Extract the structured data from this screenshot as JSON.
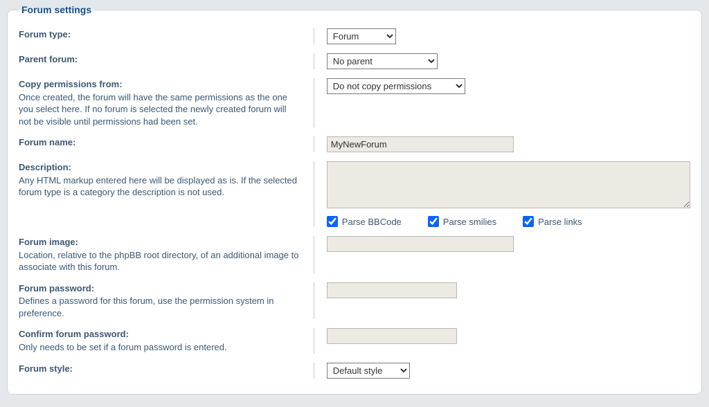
{
  "legend": "Forum settings",
  "fields": {
    "forum_type": {
      "label": "Forum type:",
      "value": "Forum"
    },
    "parent_forum": {
      "label": "Parent forum:",
      "value": "No parent"
    },
    "copy_permissions": {
      "label": "Copy permissions from:",
      "help": "Once created, the forum will have the same permissions as the one you select here. If no forum is selected the newly created forum will not be visible until permissions had been set.",
      "value": "Do not copy permissions"
    },
    "forum_name": {
      "label": "Forum name:",
      "value": "MyNewForum"
    },
    "description": {
      "label": "Description:",
      "help": "Any HTML markup entered here will be displayed as is. If the selected forum type is a category the description is not used.",
      "value": "",
      "parse_bbcode": {
        "label": "Parse BBCode",
        "checked": true
      },
      "parse_smilies": {
        "label": "Parse smilies",
        "checked": true
      },
      "parse_links": {
        "label": "Parse links",
        "checked": true
      }
    },
    "forum_image": {
      "label": "Forum image:",
      "help": "Location, relative to the phpBB root directory, of an additional image to associate with this forum.",
      "value": ""
    },
    "forum_password": {
      "label": "Forum password:",
      "help": "Defines a password for this forum, use the permission system in preference.",
      "value": ""
    },
    "confirm_password": {
      "label": "Confirm forum password:",
      "help": "Only needs to be set if a forum password is entered.",
      "value": ""
    },
    "forum_style": {
      "label": "Forum style:",
      "value": "Default style"
    }
  }
}
